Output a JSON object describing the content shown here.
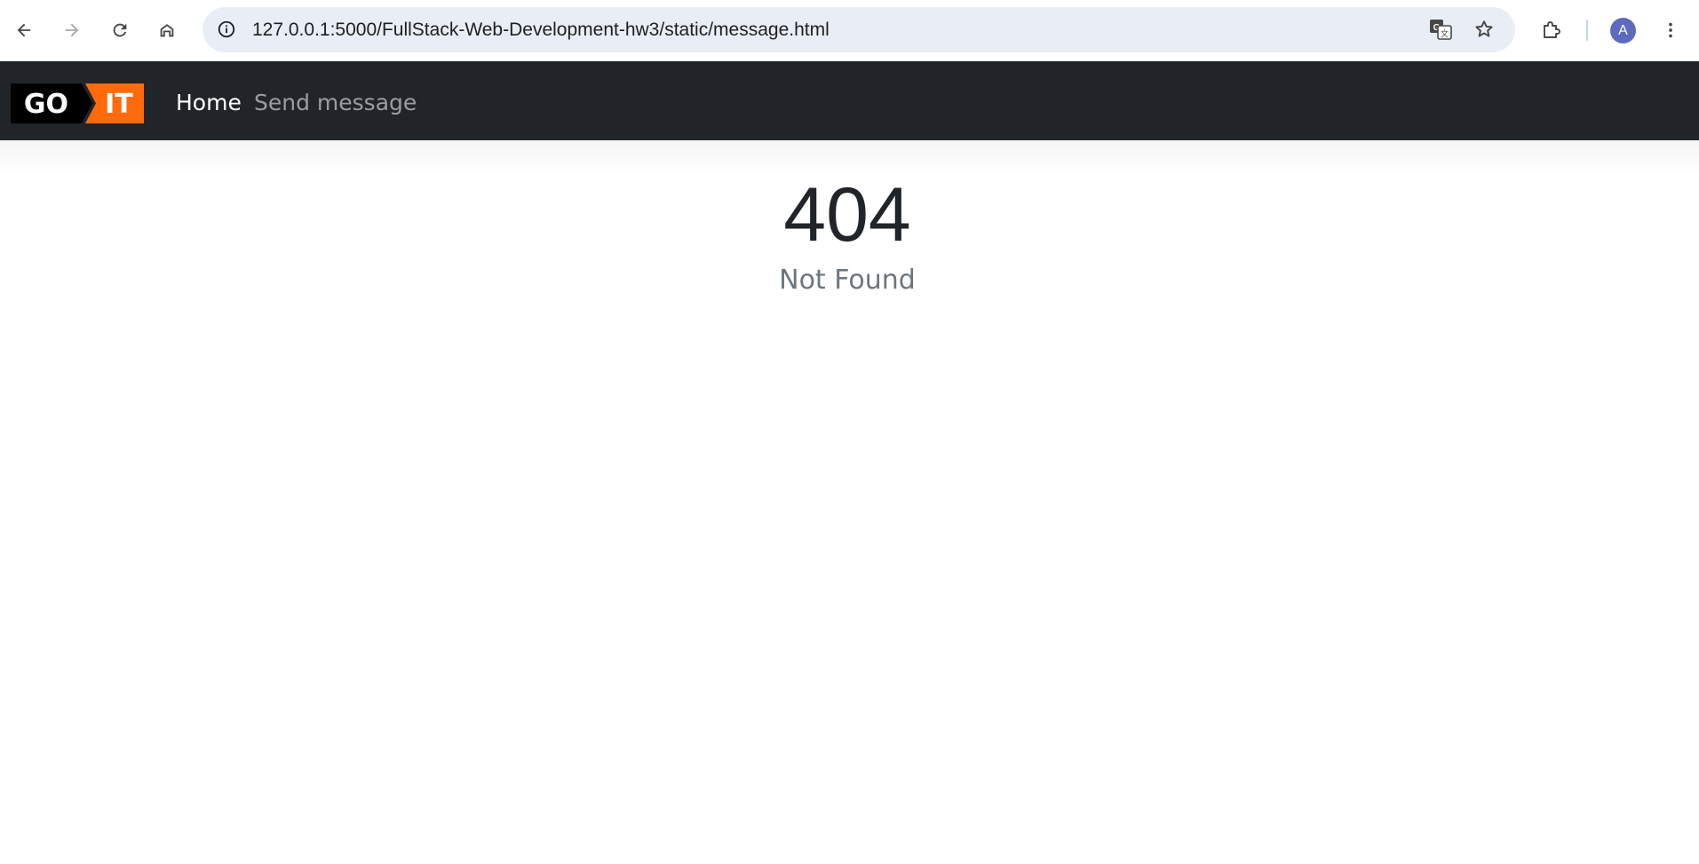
{
  "browser": {
    "url": "127.0.0.1:5000/FullStack-Web-Development-hw3/static/message.html",
    "profile_initial": "A",
    "icons": [
      "back-icon",
      "forward-icon",
      "reload-icon",
      "home-icon",
      "site-info-icon",
      "translate-icon",
      "bookmark-star-icon",
      "extensions-icon",
      "menu-icon"
    ]
  },
  "navbar": {
    "logo_text_left": "GO",
    "logo_text_right": "IT",
    "links": [
      {
        "label": "Home"
      },
      {
        "label": "Send message"
      }
    ],
    "colors": {
      "background": "#212529",
      "logo_accent": "#ff6b0a"
    }
  },
  "main": {
    "error_code": "404",
    "error_message": "Not Found"
  }
}
